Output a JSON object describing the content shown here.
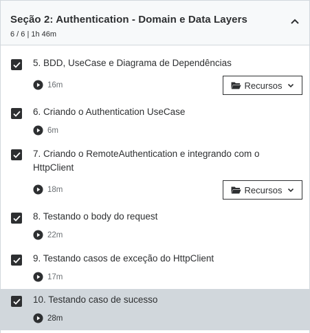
{
  "section": {
    "title": "Seção 2: Authentication - Domain e Data Layers",
    "meta": "6 / 6 | 1h 46m",
    "collapse_icon": "chevron-up-icon"
  },
  "resources_label": "Recursos",
  "lectures": [
    {
      "title": "5. BDD, UseCase e Diagrama de Dependências",
      "duration": "16m",
      "completed": true,
      "has_resources": true,
      "active": false
    },
    {
      "title": "6. Criando o Authentication UseCase",
      "duration": "6m",
      "completed": true,
      "has_resources": false,
      "active": false
    },
    {
      "title": "7. Criando o RemoteAuthentication e integrando com o HttpClient",
      "duration": "18m",
      "completed": true,
      "has_resources": true,
      "active": false
    },
    {
      "title": "8. Testando o body do request",
      "duration": "22m",
      "completed": true,
      "has_resources": false,
      "active": false
    },
    {
      "title": "9. Testando casos de exceção do HttpClient",
      "duration": "17m",
      "completed": true,
      "has_resources": false,
      "active": false
    },
    {
      "title": "10. Testando caso de sucesso",
      "duration": "28m",
      "completed": true,
      "has_resources": false,
      "active": true
    }
  ],
  "colors": {
    "text": "#2d2f31",
    "muted": "#6a6f73",
    "header_bg": "#f7f9fa",
    "active_bg": "#d1d7dc",
    "border": "#d1d7dc"
  }
}
